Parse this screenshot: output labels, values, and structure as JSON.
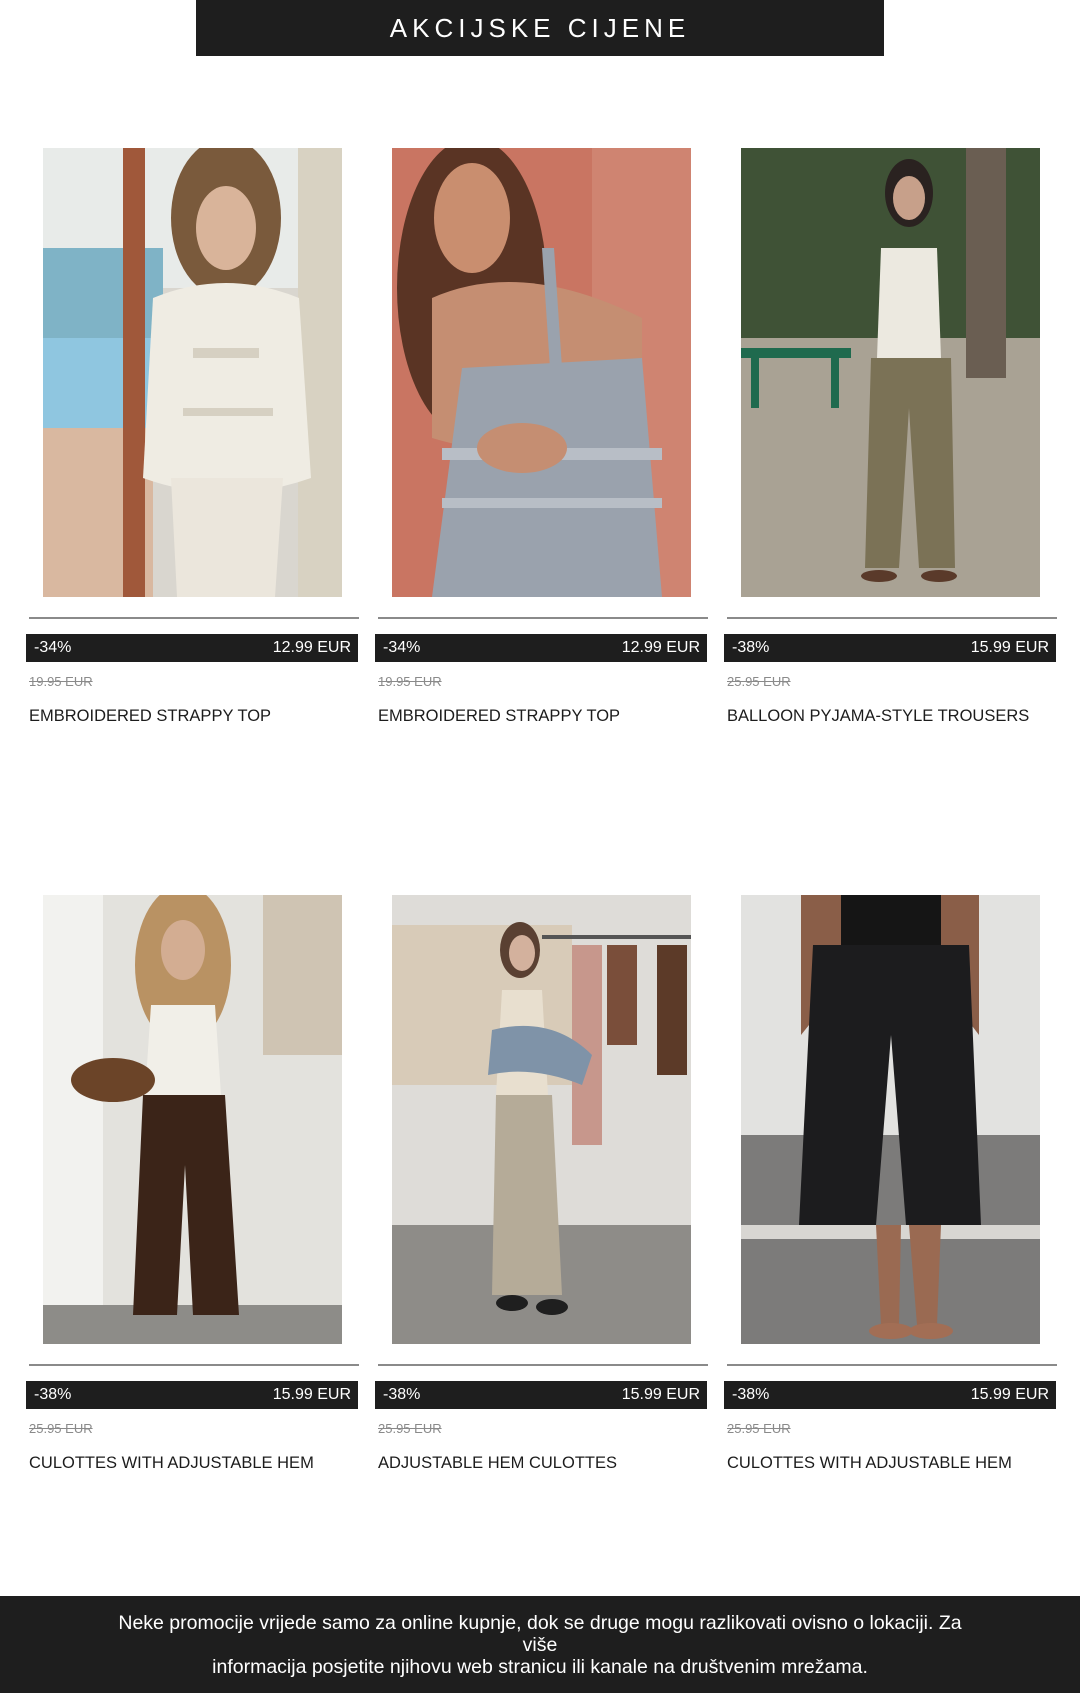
{
  "banner": {
    "title": "AKCIJSKE CIJENE"
  },
  "products": [
    {
      "discount": "-34%",
      "price": "12.99 EUR",
      "old_price": "19.95 EUR",
      "name": "EMBROIDERED STRAPPY TOP",
      "image": "white-embroidered-top-photo"
    },
    {
      "discount": "-34%",
      "price": "12.99 EUR",
      "old_price": "19.95 EUR",
      "name": "EMBROIDERED STRAPPY TOP",
      "image": "grey-embroidered-top-photo"
    },
    {
      "discount": "-38%",
      "price": "15.99 EUR",
      "old_price": "25.95 EUR",
      "name": "BALLOON PYJAMA-STYLE TROUSERS",
      "image": "khaki-trousers-photo"
    },
    {
      "discount": "-38%",
      "price": "15.99 EUR",
      "old_price": "25.95 EUR",
      "name": "CULOTTES WITH ADJUSTABLE HEM",
      "image": "brown-culottes-photo"
    },
    {
      "discount": "-38%",
      "price": "15.99 EUR",
      "old_price": "25.95 EUR",
      "name": "ADJUSTABLE HEM CULOTTES",
      "image": "beige-culottes-photo"
    },
    {
      "discount": "-38%",
      "price": "15.99 EUR",
      "old_price": "25.95 EUR",
      "name": "CULOTTES WITH ADJUSTABLE HEM",
      "image": "black-culottes-photo"
    }
  ],
  "footer": {
    "line1": "Neke promocije vrijede samo za online kupnje, dok se druge mogu razlikovati ovisno o lokaciji. Za više",
    "line2": "informacija posjetite njihovu web stranicu ili kanale na društvenim mrežama."
  },
  "colors": {
    "dark": "#1e1e1e",
    "muted": "#8a8a8a",
    "background": "#ffffff"
  }
}
